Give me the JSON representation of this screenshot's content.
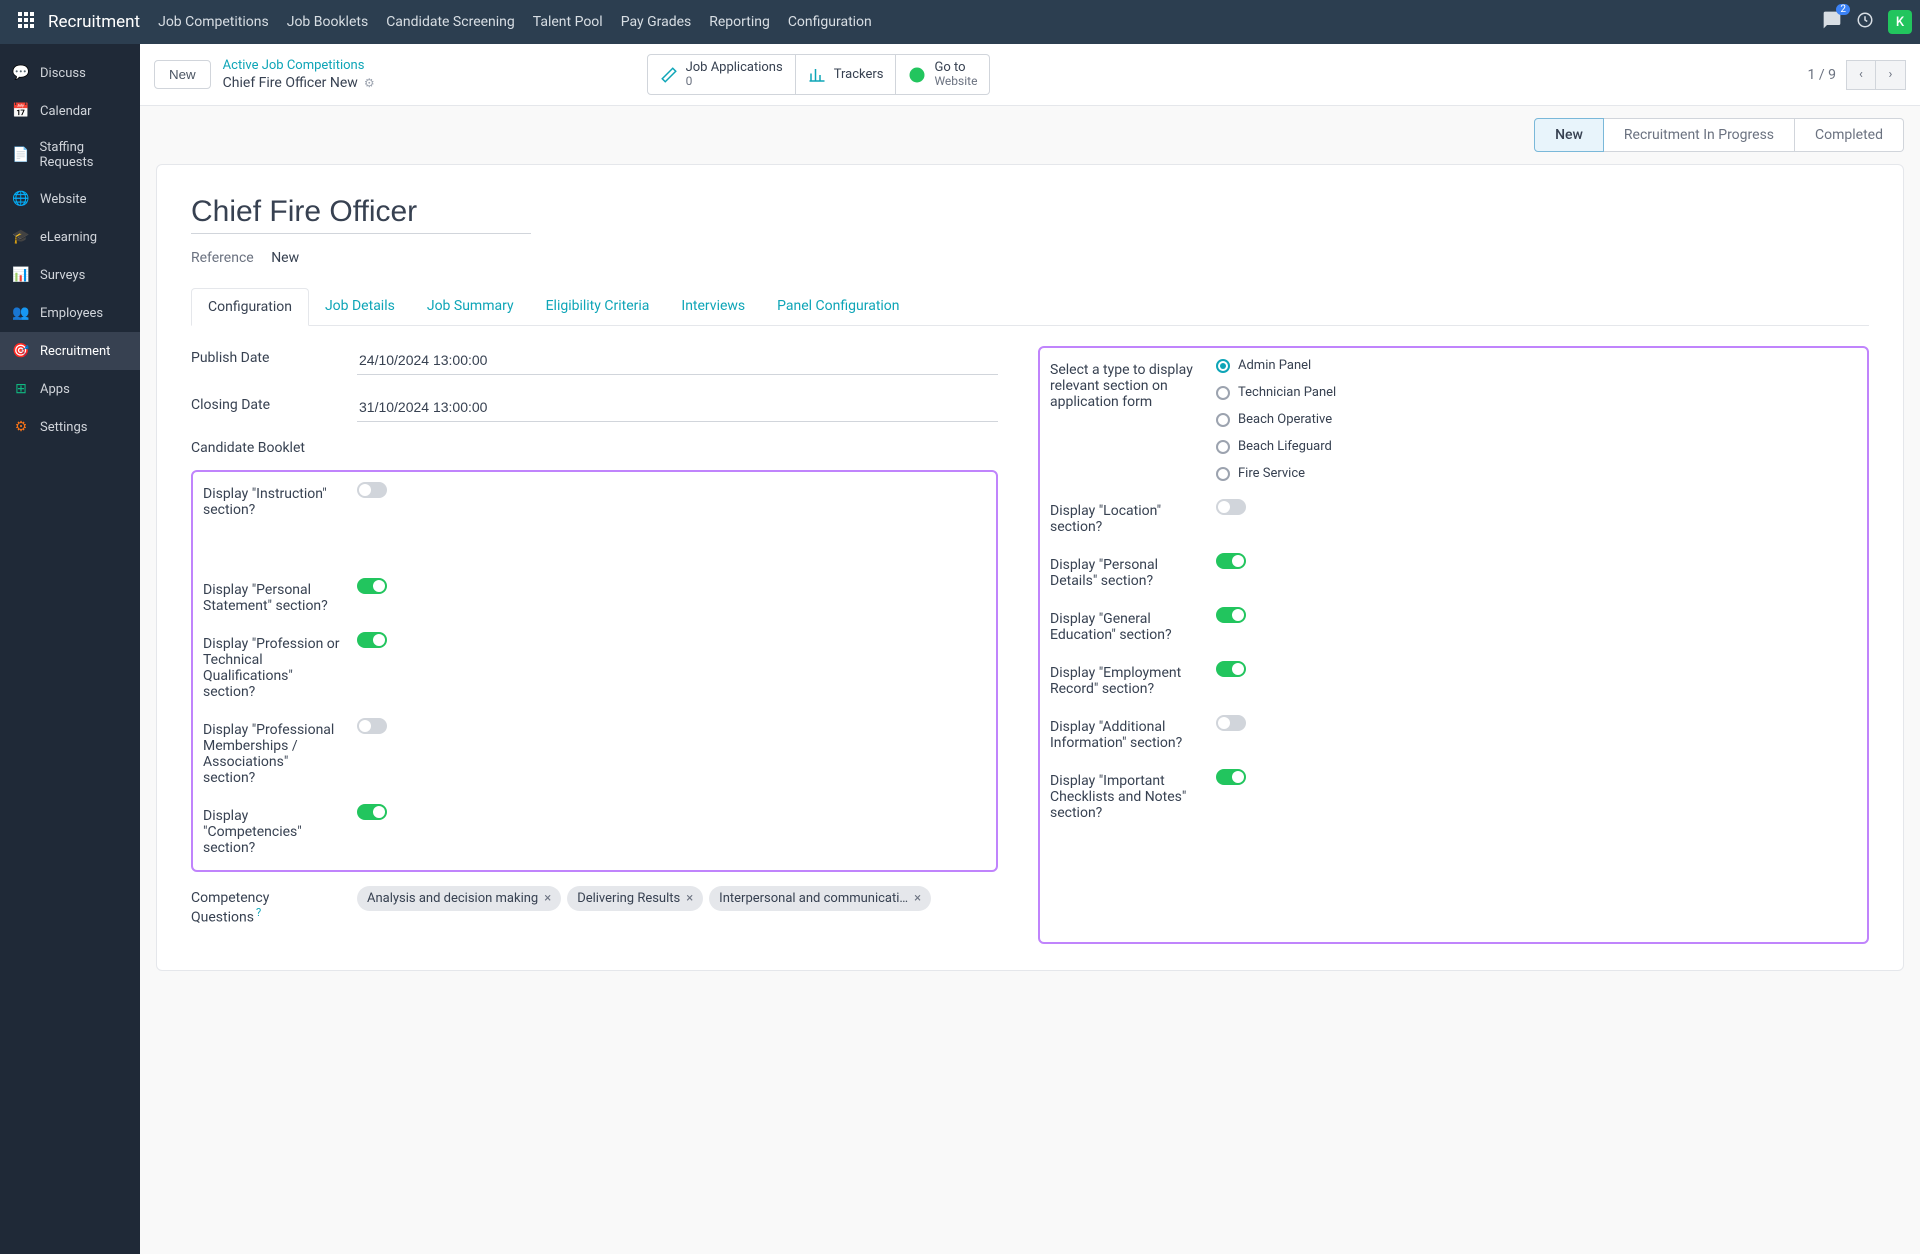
{
  "topnav": {
    "brand": "Recruitment",
    "menu": [
      "Job Competitions",
      "Job Booklets",
      "Candidate Screening",
      "Talent Pool",
      "Pay Grades",
      "Reporting",
      "Configuration"
    ],
    "chat_badge": "2",
    "avatar": "K"
  },
  "sidebar": [
    {
      "label": "Discuss"
    },
    {
      "label": "Calendar"
    },
    {
      "label": "Staffing Requests"
    },
    {
      "label": "Website"
    },
    {
      "label": "eLearning"
    },
    {
      "label": "Surveys"
    },
    {
      "label": "Employees"
    },
    {
      "label": "Recruitment",
      "active": true
    },
    {
      "label": "Apps"
    },
    {
      "label": "Settings"
    }
  ],
  "hdr": {
    "new_btn": "New",
    "crumb_top": "Active Job Competitions",
    "crumb_bottom": "Chief Fire Officer New",
    "statbtn1": {
      "label": "Job Applications",
      "sub": "0"
    },
    "statbtn2": {
      "label": "Trackers"
    },
    "statbtn3": {
      "label": "Go to",
      "sub": "Website"
    },
    "pager": "1 / 9"
  },
  "stages": {
    "s1": "New",
    "s2": "Recruitment In Progress",
    "s3": "Completed"
  },
  "form": {
    "title": "Chief Fire Officer",
    "ref_label": "Reference",
    "ref_value": "New",
    "tabs": [
      "Configuration",
      "Job Details",
      "Job Summary",
      "Eligibility Criteria",
      "Interviews",
      "Panel Configuration"
    ],
    "left": {
      "publish_label": "Publish Date",
      "publish_value": "24/10/2024 13:00:00",
      "closing_label": "Closing Date",
      "closing_value": "31/10/2024 13:00:00",
      "booklet_label": "Candidate Booklet",
      "disp_instruction": "Display \"Instruction\" section?",
      "disp_personal_statement": "Display \"Personal Statement\" section?",
      "disp_profession": "Display \"Profession or Technical Qualifications\" section?",
      "disp_memberships": "Display \"Professional Memberships / Associations\" section?",
      "disp_competencies": "Display \"Competencies\" section?",
      "competency_label": "Competency Questions",
      "tags": {
        "t0": "Analysis and decision making",
        "t1": "Delivering Results",
        "t2": "Interpersonal and communicati…"
      }
    },
    "right": {
      "type_label": "Select a type to display relevant section on application form",
      "radios": {
        "r0": "Admin Panel",
        "r1": "Technician Panel",
        "r2": "Beach Operative",
        "r3": "Beach Lifeguard",
        "r4": "Fire Service"
      },
      "disp_location": "Display \"Location\" section?",
      "disp_personal_details": "Display \"Personal Details\" section?",
      "disp_general_edu": "Display \"General Education\" section?",
      "disp_employment": "Display \"Employment Record\" section?",
      "disp_additional": "Display \"Additional Information\" section?",
      "disp_important": "Display \"Important Checklists and Notes\" section?"
    }
  }
}
